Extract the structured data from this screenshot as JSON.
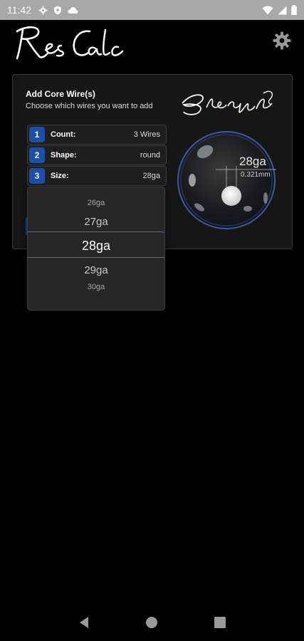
{
  "status_bar": {
    "time": "11:42",
    "icons": [
      "gear-icon",
      "shield-icon",
      "cloud-icon"
    ],
    "right_icons": [
      "wifi-icon",
      "signal-icon",
      "battery-icon"
    ]
  },
  "app": {
    "logo_text": "Res Calc",
    "settings_icon": "gear-icon"
  },
  "card": {
    "title": "Add Core Wire(s)",
    "subtitle": "Choose which wires you want to add",
    "signature_text": "BlendStyle",
    "rows": [
      {
        "num": "1",
        "label": "Count:",
        "value": "3 Wires"
      },
      {
        "num": "2",
        "label": "Shape:",
        "value": "round"
      },
      {
        "num": "3",
        "label": "Size:",
        "value": "28ga"
      }
    ],
    "preview": {
      "gauge": "28ga",
      "diameter": "0.321mm"
    }
  },
  "picker": {
    "options": [
      "26ga",
      "27ga",
      "28ga",
      "29ga",
      "30ga"
    ],
    "selected": "28ga"
  },
  "nav": {
    "icons": [
      "back-icon",
      "home-icon",
      "recents-icon"
    ]
  },
  "colors": {
    "accent": "#1c4fa8",
    "background": "#000000",
    "card": "#161616",
    "status_bar": "#a8a8a8"
  }
}
